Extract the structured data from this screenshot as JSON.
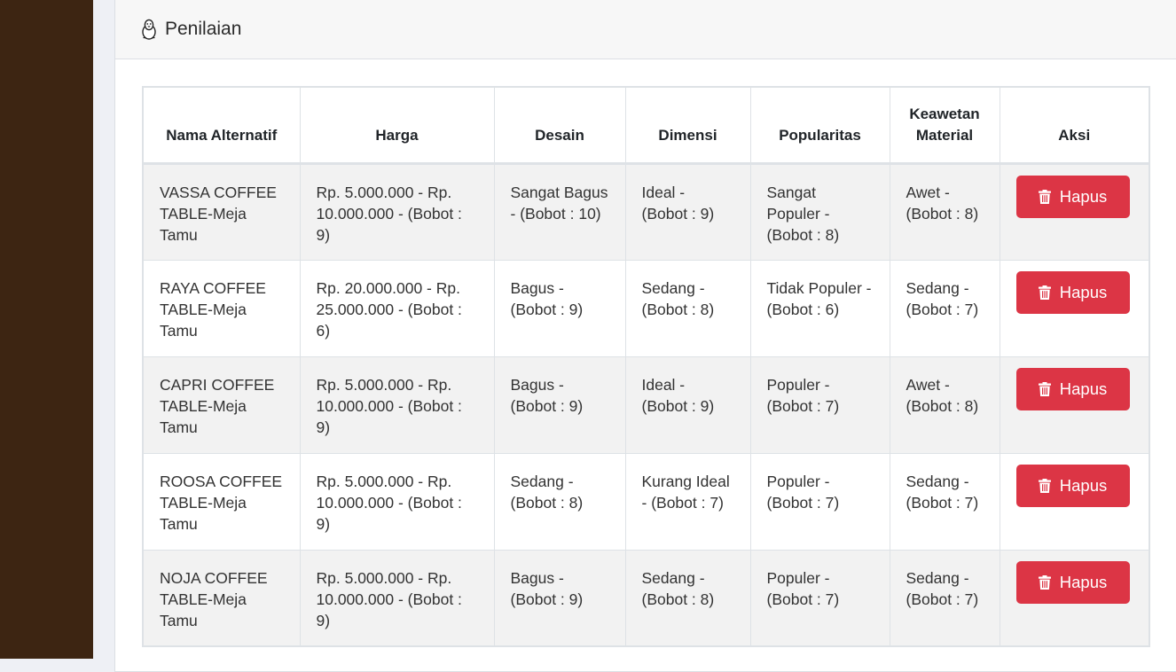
{
  "header": {
    "title": "Penilaian",
    "icon": "linux-icon"
  },
  "table": {
    "columns": [
      "Nama Alternatif",
      "Harga",
      "Desain",
      "Dimensi",
      "Popularitas",
      "Keawetan Material",
      "Aksi"
    ],
    "rows": [
      {
        "nama": "VASSA COFFEE TABLE-Meja Tamu",
        "harga": "Rp. 5.000.000 - Rp. 10.000.000 - (Bobot : 9)",
        "desain": "Sangat Bagus - (Bobot : 10)",
        "dimensi": "Ideal - (Bobot : 9)",
        "popularitas": "Sangat Populer - (Bobot : 8)",
        "keawetan": "Awet - (Bobot : 8)",
        "aksi": "Hapus"
      },
      {
        "nama": "RAYA COFFEE TABLE-Meja Tamu",
        "harga": "Rp. 20.000.000 - Rp. 25.000.000 - (Bobot : 6)",
        "desain": "Bagus - (Bobot : 9)",
        "dimensi": "Sedang - (Bobot : 8)",
        "popularitas": "Tidak Populer - (Bobot : 6)",
        "keawetan": "Sedang - (Bobot : 7)",
        "aksi": "Hapus"
      },
      {
        "nama": "CAPRI COFFEE TABLE-Meja Tamu",
        "harga": "Rp. 5.000.000 - Rp. 10.000.000 - (Bobot : 9)",
        "desain": "Bagus - (Bobot : 9)",
        "dimensi": "Ideal - (Bobot : 9)",
        "popularitas": "Populer - (Bobot : 7)",
        "keawetan": "Awet - (Bobot : 8)",
        "aksi": "Hapus"
      },
      {
        "nama": "ROOSA COFFEE TABLE-Meja Tamu",
        "harga": "Rp. 5.000.000 - Rp. 10.000.000 - (Bobot : 9)",
        "desain": "Sedang - (Bobot : 8)",
        "dimensi": "Kurang Ideal - (Bobot : 7)",
        "popularitas": "Populer - (Bobot : 7)",
        "keawetan": "Sedang - (Bobot : 7)",
        "aksi": "Hapus"
      },
      {
        "nama": "NOJA COFFEE TABLE-Meja Tamu",
        "harga": "Rp. 5.000.000 - Rp. 10.000.000 - (Bobot : 9)",
        "desain": "Bagus - (Bobot : 9)",
        "dimensi": "Sedang - (Bobot : 8)",
        "popularitas": "Populer - (Bobot : 7)",
        "keawetan": "Sedang - (Bobot : 7)",
        "aksi": "Hapus"
      }
    ]
  },
  "colors": {
    "sidebar": "#3d2512",
    "danger": "#dc3545",
    "stripe": "#f2f2f2"
  }
}
